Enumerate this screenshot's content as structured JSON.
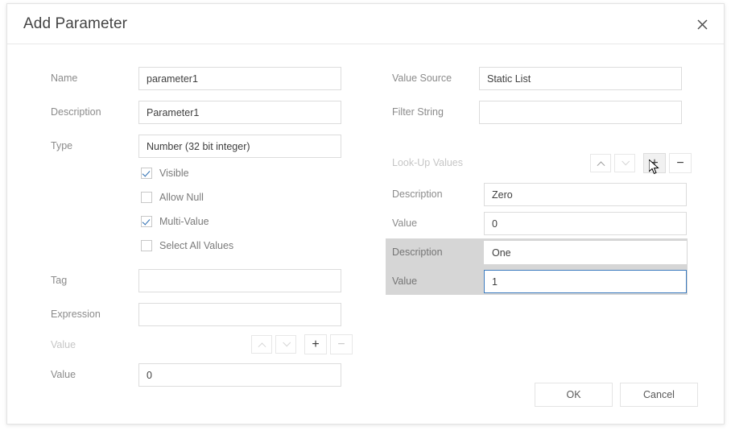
{
  "dialog": {
    "title": "Add Parameter",
    "close_icon": "close-icon"
  },
  "left_panel": {
    "fields": [
      {
        "label": "Name",
        "value": "parameter1"
      },
      {
        "label": "Description",
        "value": "Parameter1"
      },
      {
        "label": "Type",
        "value": "Number (32 bit integer)"
      }
    ],
    "checkboxes": [
      {
        "label": "Visible",
        "checked": true
      },
      {
        "label": "Allow Null",
        "checked": false
      },
      {
        "label": "Multi-Value",
        "checked": true
      },
      {
        "label": "Select All Values",
        "checked": false
      }
    ],
    "tag": {
      "label": "Tag",
      "value": ""
    },
    "expression": {
      "label": "Expression",
      "value": "",
      "button": "…"
    },
    "value_toolbar": {
      "label": "Value",
      "move_up": "▲",
      "move_down": "▼",
      "add": "+",
      "remove": "−"
    },
    "value_field": {
      "label": "Value",
      "value": "0"
    }
  },
  "right_panel": {
    "value_source": {
      "label": "Value Source",
      "value": "Static List"
    },
    "filter_string": {
      "label": "Filter String",
      "value": "",
      "button": "…"
    },
    "lookup_toolbar": {
      "label": "Look-Up Values",
      "move_up": "▲",
      "move_down": "▼",
      "add": "+",
      "remove": "−"
    },
    "lookup_rows": [
      {
        "description_label": "Description",
        "description_value": "Zero",
        "value_label": "Value",
        "value_value": "0",
        "selected": false
      },
      {
        "description_label": "Description",
        "description_value": "One",
        "value_label": "Value",
        "value_value": "1",
        "selected": true
      }
    ]
  },
  "footer": {
    "ok_label": "OK",
    "cancel_label": "Cancel"
  },
  "colors": {
    "accent_focus": "#3d7cbf",
    "checkmark": "#2a6cb0",
    "selected_row_bg": "#d6d6d6",
    "label_text": "#8b8b8b",
    "label_disabled": "#c6c6c6"
  }
}
